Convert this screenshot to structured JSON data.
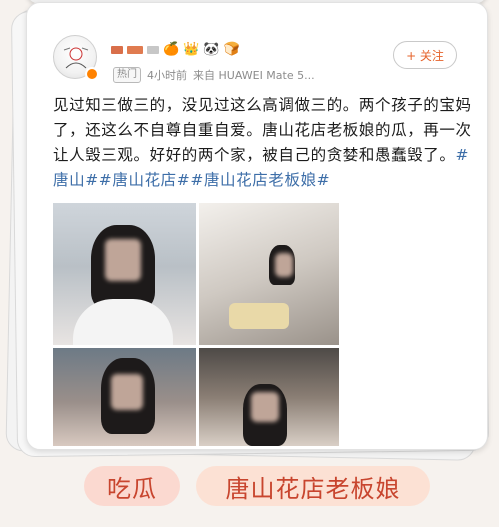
{
  "post": {
    "username_emojis": [
      "🍊",
      "👑",
      "🐼",
      "🍞"
    ],
    "hot_badge": "热门",
    "time": "4小时前",
    "source": "来自 HUAWEI Mate 5...",
    "follow_label": "+ 关注",
    "text": "见过知三做三的，没见过这么高调做三的。两个孩子的宝妈了，还这么不自尊自重自爱。唐山花店老板娘的瓜，再一次让人毁三观。好好的两个家，被自己的贪婪和愚蠢毁了。",
    "tags": [
      "#唐山#",
      "#唐山花店#",
      "#唐山花店老板娘#"
    ]
  },
  "bottom_tags": [
    "吃瓜",
    "唐山花店老板娘"
  ],
  "colors": {
    "accent_orange": "#e6632b",
    "tag_blue": "#3d6ea8",
    "pill_bg": "#fbd9d0",
    "pill_text": "#c8452e"
  }
}
